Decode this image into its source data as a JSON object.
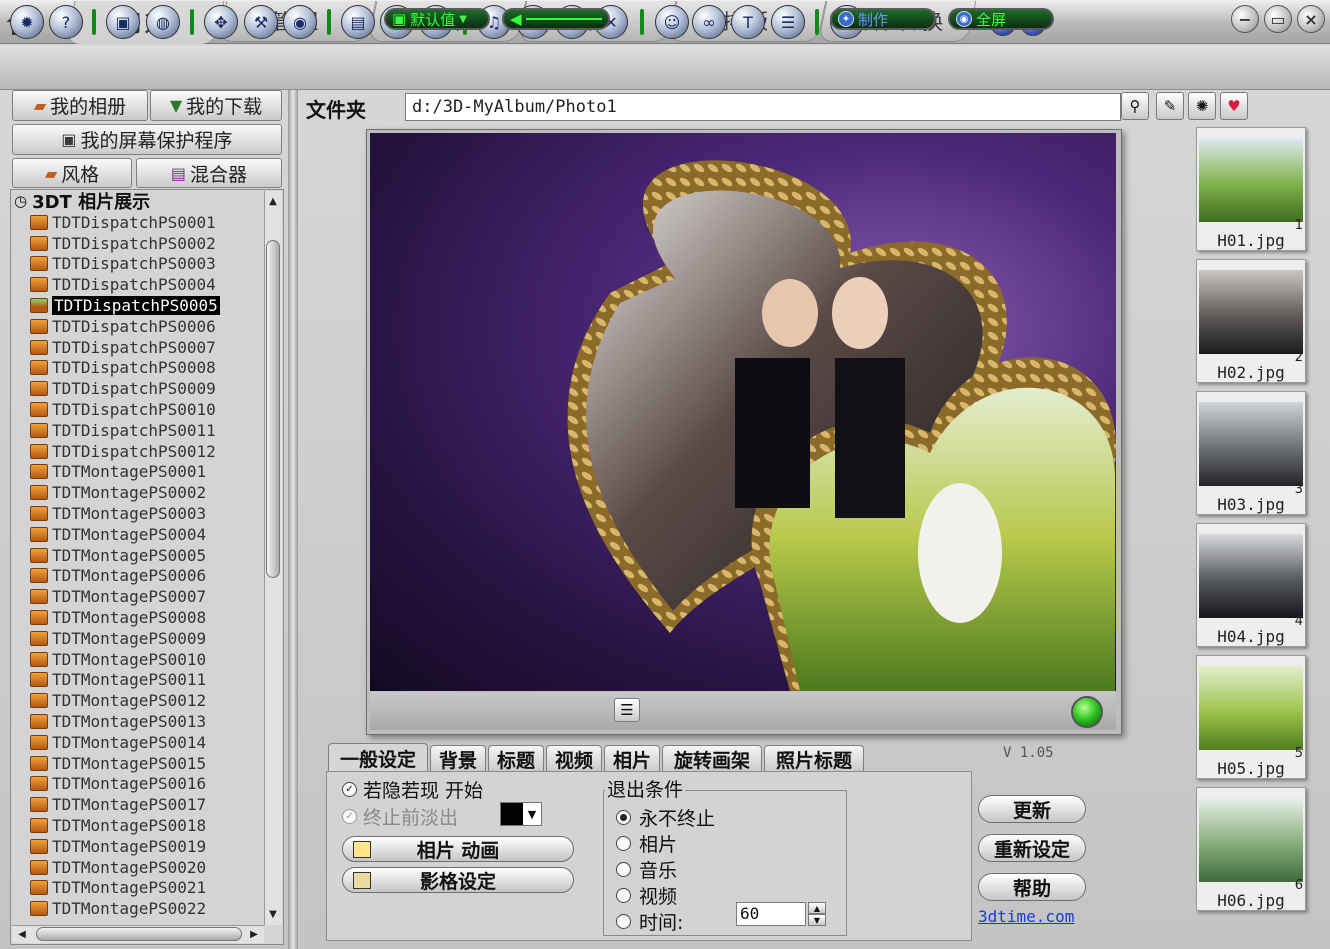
{
  "top_tabs": [
    {
      "label": "创建",
      "active": true
    },
    {
      "label": "管理"
    },
    {
      "label": "收集"
    },
    {
      "label": "编辑"
    },
    {
      "label": "排版"
    },
    {
      "label": "文件转换"
    }
  ],
  "toolbar_icons": [
    "settings-icon",
    "help-icon",
    "album-box-icon",
    "globe-icon",
    "transform-icon",
    "hammer-icon",
    "camera-icon",
    "book-icon",
    "refresh-icon",
    "folder-icon",
    "music-icon",
    "music-add-icon",
    "music-copy-icon",
    "music-delete-icon",
    "user-icon",
    "link-icon",
    "text-icon",
    "film-icon",
    "info-icon"
  ],
  "left_panel": {
    "my_album": "我的相册",
    "my_download": "我的下载",
    "screensaver": "我的屏幕保护程序",
    "style_tab": "风格",
    "mixer_tab": "混合器",
    "tree_root": "3DT  相片展示",
    "tree_items": [
      "TDTDispatchPS0001",
      "TDTDispatchPS0002",
      "TDTDispatchPS0003",
      "TDTDispatchPS0004",
      "TDTDispatchPS0005",
      "TDTDispatchPS0006",
      "TDTDispatchPS0007",
      "TDTDispatchPS0008",
      "TDTDispatchPS0009",
      "TDTDispatchPS0010",
      "TDTDispatchPS0011",
      "TDTDispatchPS0012",
      "TDTMontagePS0001",
      "TDTMontagePS0002",
      "TDTMontagePS0003",
      "TDTMontagePS0004",
      "TDTMontagePS0005",
      "TDTMontagePS0006",
      "TDTMontagePS0007",
      "TDTMontagePS0008",
      "TDTMontagePS0009",
      "TDTMontagePS0010",
      "TDTMontagePS0011",
      "TDTMontagePS0012",
      "TDTMontagePS0013",
      "TDTMontagePS0014",
      "TDTMontagePS0015",
      "TDTMontagePS0016",
      "TDTMontagePS0017",
      "TDTMontagePS0018",
      "TDTMontagePS0019",
      "TDTMontagePS0020",
      "TDTMontagePS0021",
      "TDTMontagePS0022"
    ],
    "selected_index": 4
  },
  "path": {
    "label": "文件夹",
    "value": "d:/3D-MyAlbum/Photo1"
  },
  "preview_controls": {
    "default_label": "默认值",
    "make_label": "制作",
    "fullscreen_label": "全屏"
  },
  "thumbnails": [
    {
      "name": "H01.jpg",
      "index": "1"
    },
    {
      "name": "H02.jpg",
      "index": "2"
    },
    {
      "name": "H03.jpg",
      "index": "3"
    },
    {
      "name": "H04.jpg",
      "index": "4"
    },
    {
      "name": "H05.jpg",
      "index": "5"
    },
    {
      "name": "H06.jpg",
      "index": "6"
    }
  ],
  "settings": {
    "version": "V 1.05",
    "tabs": [
      "一般设定",
      "背景",
      "标题",
      "视频",
      "相片",
      "旋转画架",
      "照片标题"
    ],
    "fade_in": "若隐若现 开始",
    "fade_out": "终止前淡出",
    "photo_animation": "相片 动画",
    "style_settings": "影格设定",
    "exit_title": "退出条件",
    "exit_options": [
      "永不终止",
      "相片",
      "音乐",
      "视频",
      "时间:"
    ],
    "time_value": "60",
    "update": "更新",
    "reset": "重新设定",
    "help": "帮助",
    "website": "3dtime.com"
  },
  "colors": {
    "pill_text": "#37ff3b",
    "selection": "#000000",
    "link": "#1a3cc8"
  }
}
